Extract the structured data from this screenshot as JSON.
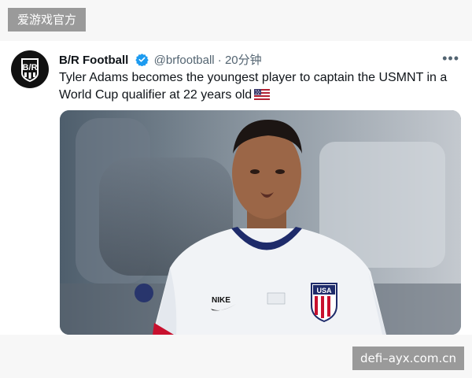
{
  "site_tag": "爱游戏官方",
  "tweet": {
    "author_name": "B/R Football",
    "handle": "@brfootball",
    "separator": "·",
    "time": "20分钟",
    "more": "•••",
    "text": "Tyler Adams becomes the youngest player to captain the USMNT in a World Cup qualifier at 22 years old",
    "avatar_text": "B/R",
    "jersey_brand": "NIKE",
    "crest_text": "USA"
  },
  "watermark": "defi–ayx.com.cn",
  "colors": {
    "verified": "#1d9bf0",
    "text": "#0f1419",
    "muted": "#536471",
    "tag_bg": "#9a9a9a"
  }
}
